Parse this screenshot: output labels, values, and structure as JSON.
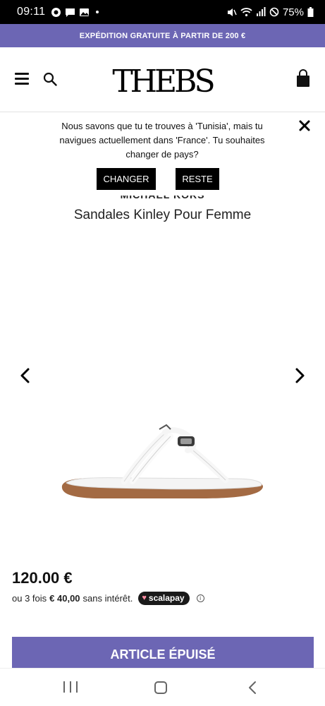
{
  "status_bar": {
    "time": "09:11",
    "battery": "75%"
  },
  "promo": {
    "text": "EXPÉDITION GRATUITE À PARTIR DE 200 €"
  },
  "header": {
    "logo_text": "THEBS"
  },
  "country_prompt": {
    "message": "Nous savons que tu te trouves à 'Tunisia', mais tu navigues actuellement dans 'France'. Tu souhaites changer de pays?",
    "change_label": "CHANGER",
    "stay_label": "RESTE"
  },
  "product": {
    "brand": "MICHAEL KORS",
    "title": "Sandales Kinley Pour Femme",
    "price": "120.00 €",
    "installment_prefix": "ou 3 fois",
    "installment_amount": "€ 40,00",
    "installment_suffix": "sans intérêt.",
    "payment_provider": "scalapay",
    "sold_out_label": "ARTICLE ÉPUISÉ"
  },
  "icons": {
    "menu": "hamburger-menu-icon",
    "search": "search-icon",
    "cart": "shopping-bag-icon",
    "close": "close-icon",
    "prev": "chevron-left-icon",
    "next": "chevron-right-icon",
    "info": "info-icon"
  },
  "colors": {
    "brand_purple": "#6c66b4",
    "black": "#000000"
  }
}
